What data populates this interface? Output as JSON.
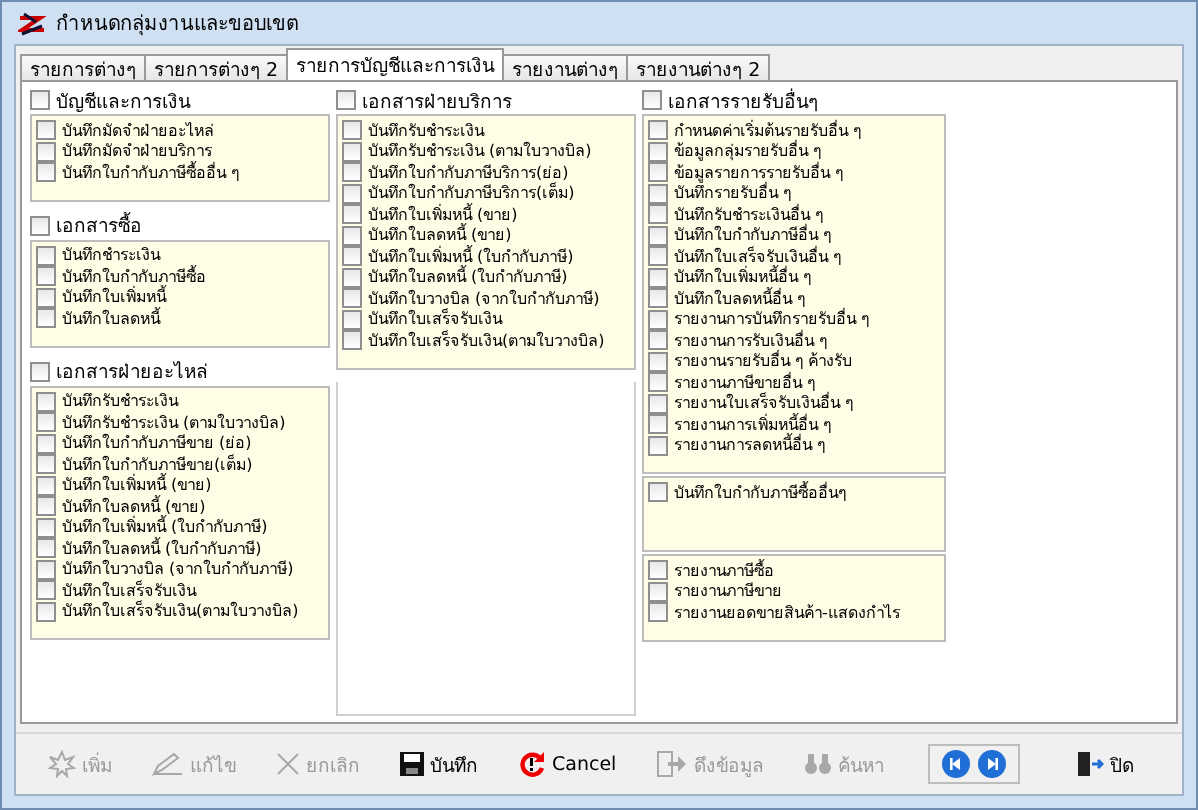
{
  "window": {
    "title": "กำหนดกลุ่มงานและขอบเขต"
  },
  "tabs": [
    {
      "label": "รายการต่างๆ",
      "selected": false
    },
    {
      "label": "รายการต่างๆ 2",
      "selected": false
    },
    {
      "label": "รายการบัญชีและการเงิน",
      "selected": true
    },
    {
      "label": "รายงานต่างๆ",
      "selected": false
    },
    {
      "label": "รายงานต่างๆ 2",
      "selected": false
    }
  ],
  "columns": [
    {
      "groups": [
        {
          "label": "บัญชีและการเงิน",
          "checked": false,
          "boxes": [
            {
              "items": [
                {
                  "label": "บันทึกมัดจำฝ่ายอะไหล่",
                  "checked": false
                },
                {
                  "label": "บันทึกมัดจำฝ่ายบริการ",
                  "checked": false
                },
                {
                  "label": "บันทึกใบกำกับภาษีซื้ออื่น ๆ",
                  "checked": false
                }
              ]
            }
          ]
        },
        {
          "label": "เอกสารซื้อ",
          "checked": false,
          "boxes": [
            {
              "items": [
                {
                  "label": "บันทึกชำระเงิน",
                  "checked": false
                },
                {
                  "label": "บันทึกใบกำกับภาษีซื้อ",
                  "checked": false
                },
                {
                  "label": "บันทึกใบเพิ่มหนี้",
                  "checked": false
                },
                {
                  "label": "บันทึกใบลดหนี้",
                  "checked": false
                }
              ]
            }
          ]
        },
        {
          "label": "เอกสารฝ่ายอะไหล่",
          "checked": false,
          "boxes": [
            {
              "items": [
                {
                  "label": "บันทึกรับชำระเงิน",
                  "checked": false
                },
                {
                  "label": "บันทึกรับชำระเงิน (ตามใบวางบิล)",
                  "checked": false
                },
                {
                  "label": "บันทึกใบกำกับภาษีขาย (ย่อ)",
                  "checked": false
                },
                {
                  "label": "บันทึกใบกำกับภาษีขาย(เต็ม)",
                  "checked": false
                },
                {
                  "label": "บันทึกใบเพิ่มหนี้ (ขาย)",
                  "checked": false
                },
                {
                  "label": "บันทึกใบลดหนี้ (ขาย)",
                  "checked": false
                },
                {
                  "label": "บันทึกใบเพิ่มหนี้ (ใบกำกับภาษี)",
                  "checked": false
                },
                {
                  "label": "บันทึกใบลดหนี้ (ใบกำกับภาษี)",
                  "checked": false
                },
                {
                  "label": "บันทึกใบวางบิล (จากใบกำกับภาษี)",
                  "checked": false
                },
                {
                  "label": "บันทึกใบเสร็จรับเงิน",
                  "checked": false
                },
                {
                  "label": "บันทึกใบเสร็จรับเงิน(ตามใบวางบิล)",
                  "checked": false
                }
              ]
            }
          ]
        }
      ]
    },
    {
      "groups": [
        {
          "label": "เอกสารฝ่ายบริการ",
          "checked": false,
          "boxes": [
            {
              "items": [
                {
                  "label": "บันทึกรับชำระเงิน",
                  "checked": false
                },
                {
                  "label": "บันทึกรับชำระเงิน (ตามใบวางบิล)",
                  "checked": false
                },
                {
                  "label": "บันทึกใบกำกับภาษีบริการ(ย่อ)",
                  "checked": false
                },
                {
                  "label": "บันทึกใบกำกับภาษีบริการ(เต็ม)",
                  "checked": false
                },
                {
                  "label": "บันทึกใบเพิ่มหนี้ (ขาย)",
                  "checked": false
                },
                {
                  "label": "บันทึกใบลดหนี้ (ขาย)",
                  "checked": false
                },
                {
                  "label": "บันทึกใบเพิ่มหนี้ (ใบกำกับภาษี)",
                  "checked": false
                },
                {
                  "label": "บันทึกใบลดหนี้ (ใบกำกับภาษี)",
                  "checked": false
                },
                {
                  "label": "บันทึกใบวางบิล (จากใบกำกับภาษี)",
                  "checked": false
                },
                {
                  "label": "บันทึกใบเสร็จรับเงิน",
                  "checked": false
                },
                {
                  "label": "บันทึกใบเสร็จรับเงิน(ตามใบวางบิล)",
                  "checked": false
                }
              ]
            }
          ]
        }
      ]
    },
    {
      "groups": [
        {
          "label": "เอกสารรายรับอื่นๆ",
          "checked": false,
          "boxes": [
            {
              "items": [
                {
                  "label": "กำหนดค่าเริ่มต้นรายรับอื่น ๆ",
                  "checked": false
                },
                {
                  "label": "ข้อมูลกลุ่มรายรับอื่น ๆ",
                  "checked": false
                },
                {
                  "label": "ข้อมูลรายการรายรับอื่น ๆ",
                  "checked": false
                },
                {
                  "label": "บันทึกรายรับอื่น ๆ",
                  "checked": false
                },
                {
                  "label": "บันทึกรับชำระเงินอื่น ๆ",
                  "checked": false
                },
                {
                  "label": "บันทึกใบกำกับภาษีอื่น ๆ",
                  "checked": false
                },
                {
                  "label": "บันทึกใบเสร็จรับเงินอื่น ๆ",
                  "checked": false
                },
                {
                  "label": "บันทึกใบเพิ่มหนี้อื่น ๆ",
                  "checked": false
                },
                {
                  "label": "บันทึกใบลดหนี้อื่น ๆ",
                  "checked": false
                },
                {
                  "label": "รายงานการบันทึกรายรับอื่น ๆ",
                  "checked": false
                },
                {
                  "label": "รายงานการรับเงินอื่น ๆ",
                  "checked": false
                },
                {
                  "label": "รายงานรายรับอื่น ๆ ค้างรับ",
                  "checked": false
                },
                {
                  "label": "รายงานภาษีขายอื่น ๆ",
                  "checked": false
                },
                {
                  "label": "รายงานใบเสร็จรับเงินอื่น ๆ",
                  "checked": false
                },
                {
                  "label": "รายงานการเพิ่มหนี้อื่น ๆ",
                  "checked": false
                },
                {
                  "label": "รายงานการลดหนี้อื่น ๆ",
                  "checked": false
                }
              ]
            },
            {
              "items": [
                {
                  "label": "บันทึกใบกำกับภาษีซื้ออื่นๆ",
                  "checked": false
                }
              ]
            },
            {
              "items": [
                {
                  "label": "รายงานภาษีซื้อ",
                  "checked": false
                },
                {
                  "label": "รายงานภาษีขาย",
                  "checked": false
                },
                {
                  "label": "รายงานยอดขายสินค้า-แสดงกำไร",
                  "checked": false
                }
              ]
            }
          ]
        }
      ]
    }
  ],
  "toolbar": [
    {
      "kind": "add",
      "label": "เพิ่ม",
      "disabled": true
    },
    {
      "kind": "edit",
      "label": "แก้ไข",
      "disabled": true
    },
    {
      "kind": "remove",
      "label": "ยกเลิก",
      "disabled": true
    },
    {
      "kind": "save",
      "label": "บันทึก",
      "disabled": false
    },
    {
      "kind": "undo",
      "label": "Cancel",
      "disabled": false
    },
    {
      "kind": "fetch",
      "label": "ดึงข้อมูล",
      "disabled": true
    },
    {
      "kind": "find",
      "label": "ค้นหา",
      "disabled": true
    }
  ],
  "nav": [
    {
      "kind": "prev"
    },
    {
      "kind": "next"
    }
  ],
  "close_button": {
    "label": "ปิด"
  }
}
